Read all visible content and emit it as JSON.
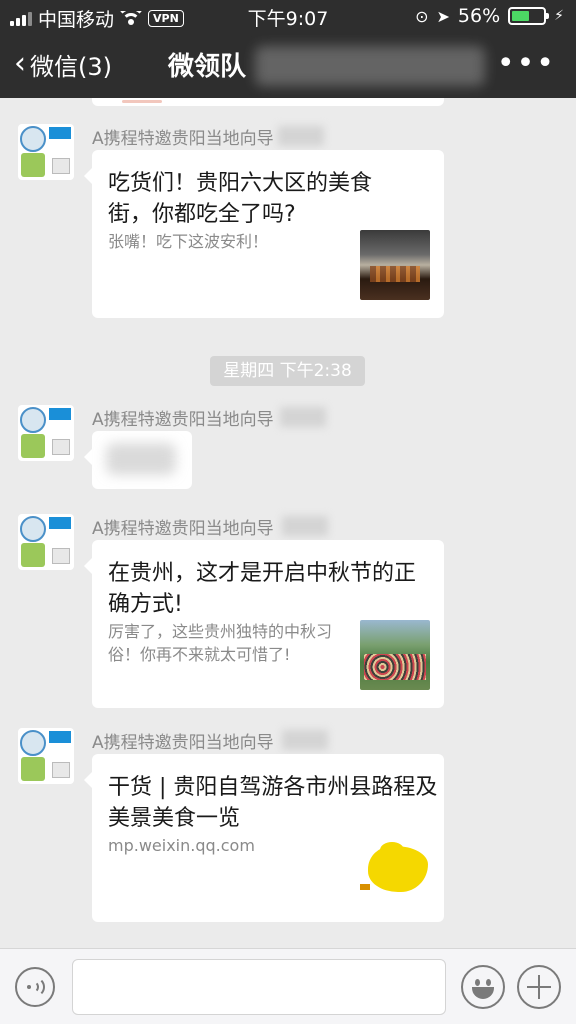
{
  "status_bar": {
    "carrier": "中国移动",
    "vpn": "VPN",
    "time": "下午9:07",
    "battery_percent": "56%",
    "battery_level": 0.56
  },
  "nav": {
    "back_label": "微信(3)",
    "title": "微领队",
    "more_icon": "more-dots-icon"
  },
  "messages": [
    {
      "sender": "A携程特邀贵阳当地向导",
      "title": "吃货们！贵阳六大区的美食街，你都吃全了吗?",
      "desc": "张嘴！吃下这波安利！",
      "thumb": "grill-food-thumbnail"
    },
    {
      "timestamp": "星期四 下午2:38"
    },
    {
      "sender": "A携程特邀贵阳当地向导",
      "blurred": true
    },
    {
      "sender": "A携程特邀贵阳当地向导",
      "title": "在贵州，这才是开启中秋节的正确方式!",
      "desc": "厉害了，这些贵州独特的中秋习俗！你再不来就太可惜了!",
      "thumb": "festival-crowd-thumbnail"
    },
    {
      "sender": "A携程特邀贵阳当地向导",
      "title": "干货 | 贵阳自驾游各市州县路程及美景美食一览",
      "desc": "mp.weixin.qq.com",
      "thumb": "guizhou-map-thumbnail"
    }
  ],
  "input_bar": {
    "voice_icon": "voice-icon",
    "emoji_icon": "emoji-icon",
    "plus_icon": "plus-icon"
  }
}
